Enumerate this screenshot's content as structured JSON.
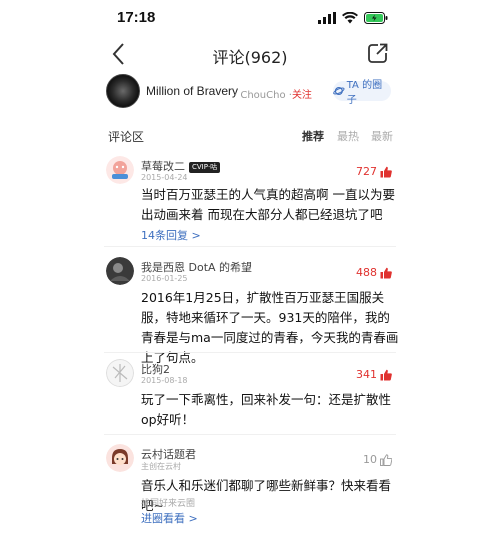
{
  "status": {
    "time": "17:18"
  },
  "nav": {
    "title": "评论(962)"
  },
  "creator": {
    "name": "Million of Bravery",
    "sub": "· ChouCho ·",
    "follow": "关注",
    "circle_label": "TA 的圈子"
  },
  "section": {
    "title": "评论区",
    "sort": [
      "推荐",
      "最热",
      "最新"
    ]
  },
  "comments": [
    {
      "user": "草莓改二",
      "badge": "CVIP·咕",
      "date": "2015-04-24",
      "likes": "727",
      "text": "当时百万亚瑟王的人气真的超高啊 一直以为要出动画来着  而现在大部分人都已经退坑了吧",
      "replies": "14条回复 >"
    },
    {
      "user": "我是西恩 DotA 的希望",
      "date": "2016-01-25",
      "likes": "488",
      "text": "2016年1月25日，扩散性百万亚瑟王国服关服，特地来循环了一天。931天的陪伴，我的青春是与ma一同度过的青春，今天我的青春画上了句点。"
    },
    {
      "user": "比狗2",
      "date": "2015-08-18",
      "likes": "341",
      "text": "玩了一下乖离性，回来补发一句：还是扩散性op好听！"
    },
    {
      "user": "云村话题君",
      "date": "主创在云村",
      "likes": "10",
      "text": "音乐人和乐迷们都聊了哪些新鲜事？快来看看吧~",
      "sub": "找同好来云圈",
      "link": "进圈看看 >"
    }
  ],
  "colors": {
    "accent": "#e0322f",
    "link": "#3e6fbf"
  }
}
